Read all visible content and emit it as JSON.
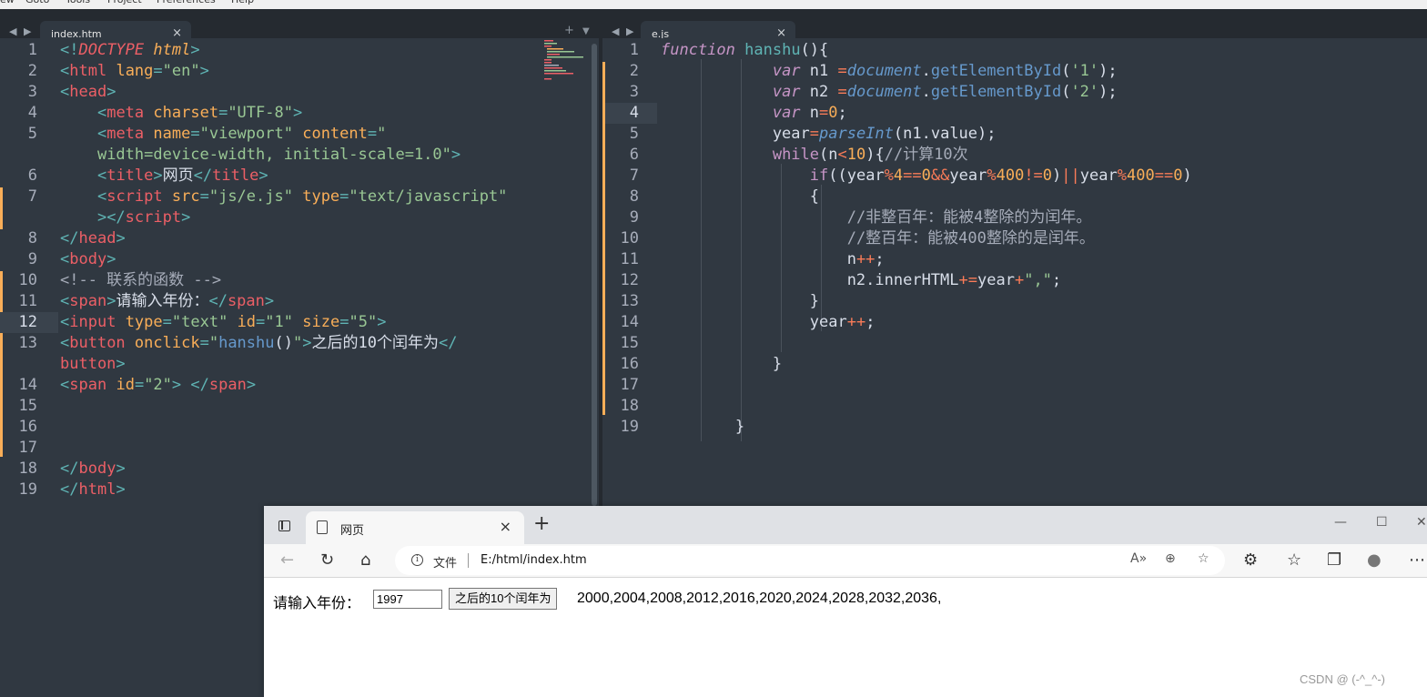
{
  "menu": [
    "ew",
    "Goto",
    "Tools",
    "Project",
    "Preferences",
    "Help"
  ],
  "left_tab": {
    "name": "index.htm",
    "close": "×"
  },
  "right_tab": {
    "name": "e.js",
    "close": "×"
  },
  "left_code": [
    {
      "n": "1",
      "html": "<span class='p'>&lt;!</span><span class='t it'>DOCTYPE</span> <span class='a it'>html</span><span class='p'>&gt;</span>"
    },
    {
      "n": "2",
      "html": "<span class='p'>&lt;</span><span class='t'>html</span> <span class='a'>lang</span><span class='p'>=</span><span class='s'>\"en\"</span><span class='p'>&gt;</span>"
    },
    {
      "n": "3",
      "html": "<span class='p'>&lt;</span><span class='t'>head</span><span class='p'>&gt;</span>"
    },
    {
      "n": "4",
      "html": "    <span class='p'>&lt;</span><span class='t'>meta</span> <span class='a'>charset</span><span class='p'>=</span><span class='s'>\"UTF-8\"</span><span class='p'>&gt;</span>"
    },
    {
      "n": "5",
      "html": "    <span class='p'>&lt;</span><span class='t'>meta</span> <span class='a'>name</span><span class='p'>=</span><span class='s'>\"viewport\"</span> <span class='a'>content</span><span class='p'>=</span><span class='s'>\"</span>"
    },
    {
      "n": "",
      "html": "    <span class='s'>width=device-width, initial-scale=1.0\"</span><span class='p'>&gt;</span>"
    },
    {
      "n": "6",
      "html": "    <span class='p'>&lt;</span><span class='t'>title</span><span class='p'>&gt;</span>网页<span class='p'>&lt;/</span><span class='t'>title</span><span class='p'>&gt;</span>"
    },
    {
      "n": "7",
      "html": "    <span class='p'>&lt;</span><span class='t'>script</span> <span class='a'>src</span><span class='p'>=</span><span class='s'>\"js/e.js\"</span> <span class='a'>type</span><span class='p'>=</span><span class='s'>\"text/javascript\"</span>"
    },
    {
      "n": "",
      "html": "    <span class='p'>&gt;&lt;/</span><span class='t'>script</span><span class='p'>&gt;</span>"
    },
    {
      "n": "8",
      "html": "<span class='p'>&lt;/</span><span class='t'>head</span><span class='p'>&gt;</span>"
    },
    {
      "n": "9",
      "html": "<span class='p'>&lt;</span><span class='t'>body</span><span class='p'>&gt;</span>"
    },
    {
      "n": "10",
      "html": "<span class='c'>&lt;!-- 联系的函数 --&gt;</span>"
    },
    {
      "n": "11",
      "html": "<span class='p'>&lt;</span><span class='t'>span</span><span class='p'>&gt;</span>请输入年份：<span class='p'>&lt;/</span><span class='t'>span</span><span class='p'>&gt;</span>"
    },
    {
      "n": "12",
      "html": "<span class='p'>&lt;</span><span class='t'>input</span> <span class='a'>type</span><span class='p'>=</span><span class='s'>\"text\"</span> <span class='a'>id</span><span class='p'>=</span><span class='s'>\"1\"</span> <span class='a'>size</span><span class='p'>=</span><span class='s'>\"5\"</span><span class='p'>&gt;</span>"
    },
    {
      "n": "13",
      "html": "<span class='p'>&lt;</span><span class='t'>button</span> <span class='a'>onclick</span><span class='p'>=</span><span class='s'>\"</span><span class='mth'>hanshu</span>()<span class='s'>\"</span><span class='p'>&gt;</span>之后的10个闰年为<span class='p'>&lt;/</span>"
    },
    {
      "n": "",
      "html": "<span class='t'>button</span><span class='p'>&gt;</span>"
    },
    {
      "n": "14",
      "html": "<span class='p'>&lt;</span><span class='t'>span</span> <span class='a'>id</span><span class='p'>=</span><span class='s'>\"2\"</span><span class='p'>&gt;</span> <span class='p'>&lt;/</span><span class='t'>span</span><span class='p'>&gt;</span>"
    },
    {
      "n": "15",
      "html": ""
    },
    {
      "n": "16",
      "html": ""
    },
    {
      "n": "17",
      "html": ""
    },
    {
      "n": "18",
      "html": "<span class='p'>&lt;/</span><span class='t'>body</span><span class='p'>&gt;</span>"
    },
    {
      "n": "19",
      "html": "<span class='p'>&lt;/</span><span class='t'>html</span><span class='p'>&gt;</span>"
    }
  ],
  "right_code": [
    {
      "n": "1",
      "html": "<span class='kw'>function</span> <span class='fn'>hanshu</span>(){"
    },
    {
      "n": "2",
      "html": "            <span class='kw'>var</span> n1 <span class='op'>=</span><span class='bl'>document</span>.<span class='mth'>getElementById</span>(<span class='s'>'1'</span>);"
    },
    {
      "n": "3",
      "html": "            <span class='kw'>var</span> n2 <span class='op'>=</span><span class='bl'>document</span>.<span class='mth'>getElementById</span>(<span class='s'>'2'</span>);"
    },
    {
      "n": "4",
      "html": "            <span class='kw'>var</span> n<span class='op'>=</span><span class='nm'>0</span>;"
    },
    {
      "n": "5",
      "html": "            year<span class='op'>=</span><span class='bl'>parseInt</span>(n1.value);"
    },
    {
      "n": "6",
      "html": "            <span class='kw' style='font-style:normal'>while</span>(n<span class='op'>&lt;</span><span class='nm'>10</span>){<span class='c'>//计算10次</span>"
    },
    {
      "n": "7",
      "html": "                <span class='kw' style='font-style:normal'>if</span>((year<span class='op'>%</span><span class='nm'>4</span><span class='op'>==</span><span class='nm'>0</span><span class='op'>&amp;&amp;</span>year<span class='op'>%</span><span class='nm'>400</span><span class='op'>!=</span><span class='nm'>0</span>)<span class='op'>||</span>year<span class='op'>%</span><span class='nm'>400</span><span class='op'>==</span><span class='nm'>0</span>)"
    },
    {
      "n": "8",
      "html": "                {"
    },
    {
      "n": "9",
      "html": "                    <span class='c'>//非整百年：能被4整除的为闰年。</span>"
    },
    {
      "n": "10",
      "html": "                    <span class='c'>//整百年：能被400整除的是闰年。</span>"
    },
    {
      "n": "11",
      "html": "                    n<span class='op'>++</span>;"
    },
    {
      "n": "12",
      "html": "                    n2.innerHTML<span class='op'>+=</span>year<span class='op'>+</span><span class='s'>\",\"</span>;"
    },
    {
      "n": "13",
      "html": "                }"
    },
    {
      "n": "14",
      "html": "                year<span class='op'>++</span>;"
    },
    {
      "n": "15",
      "html": ""
    },
    {
      "n": "16",
      "html": "            }"
    },
    {
      "n": "17",
      "html": ""
    },
    {
      "n": "18",
      "html": ""
    },
    {
      "n": "19",
      "html": "        }"
    }
  ],
  "browser": {
    "tab_title": "网页",
    "tab_close": "×",
    "new_tab": "+",
    "address_label": "文件",
    "url": "E:/html/index.htm",
    "prompt": "请输入年份：",
    "input_value": "1997",
    "button_label": "之后的10个闰年为",
    "result": "2000,2004,2008,2012,2016,2020,2024,2028,2032,2036,",
    "watermark": "CSDN @ (-^_^-)"
  },
  "colors": {
    "editor_bg": "#303841",
    "tag": "#ec5f66",
    "attr": "#f9ae58",
    "string": "#99c794",
    "keyword": "#c695c6",
    "modified": "#f9ae58"
  }
}
